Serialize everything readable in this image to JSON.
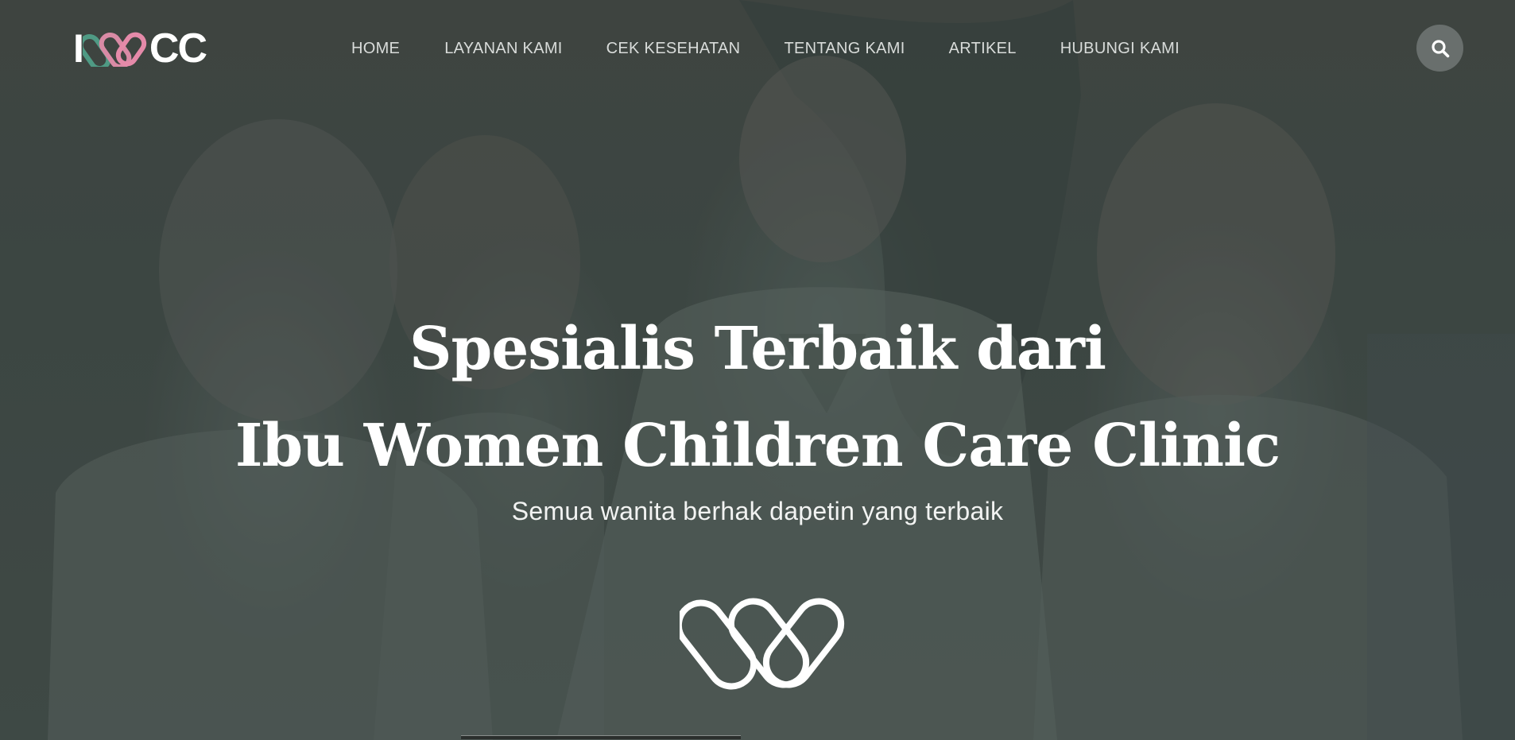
{
  "brand": {
    "logo_prefix": "I",
    "logo_suffix": "CC",
    "logo_mark_icon": "heart-ribbon-icon",
    "colors": {
      "green": "#4f9a84",
      "pink": "#e58aa9",
      "white": "#ffffff"
    }
  },
  "nav": {
    "items": [
      {
        "label": "HOME"
      },
      {
        "label": "LAYANAN KAMI"
      },
      {
        "label": "CEK KESEHATAN"
      },
      {
        "label": "TENTANG KAMI"
      },
      {
        "label": "ARTIKEL"
      },
      {
        "label": "HUBUNGI KAMI"
      }
    ],
    "search_icon": "search-icon"
  },
  "hero": {
    "title_line1": "Spesialis Terbaik dari",
    "title_line2": "Ibu Women Children Care Clinic",
    "subtitle": "Semua wanita berhak dapetin yang terbaik",
    "mark_icon": "w-ribbon-icon"
  }
}
